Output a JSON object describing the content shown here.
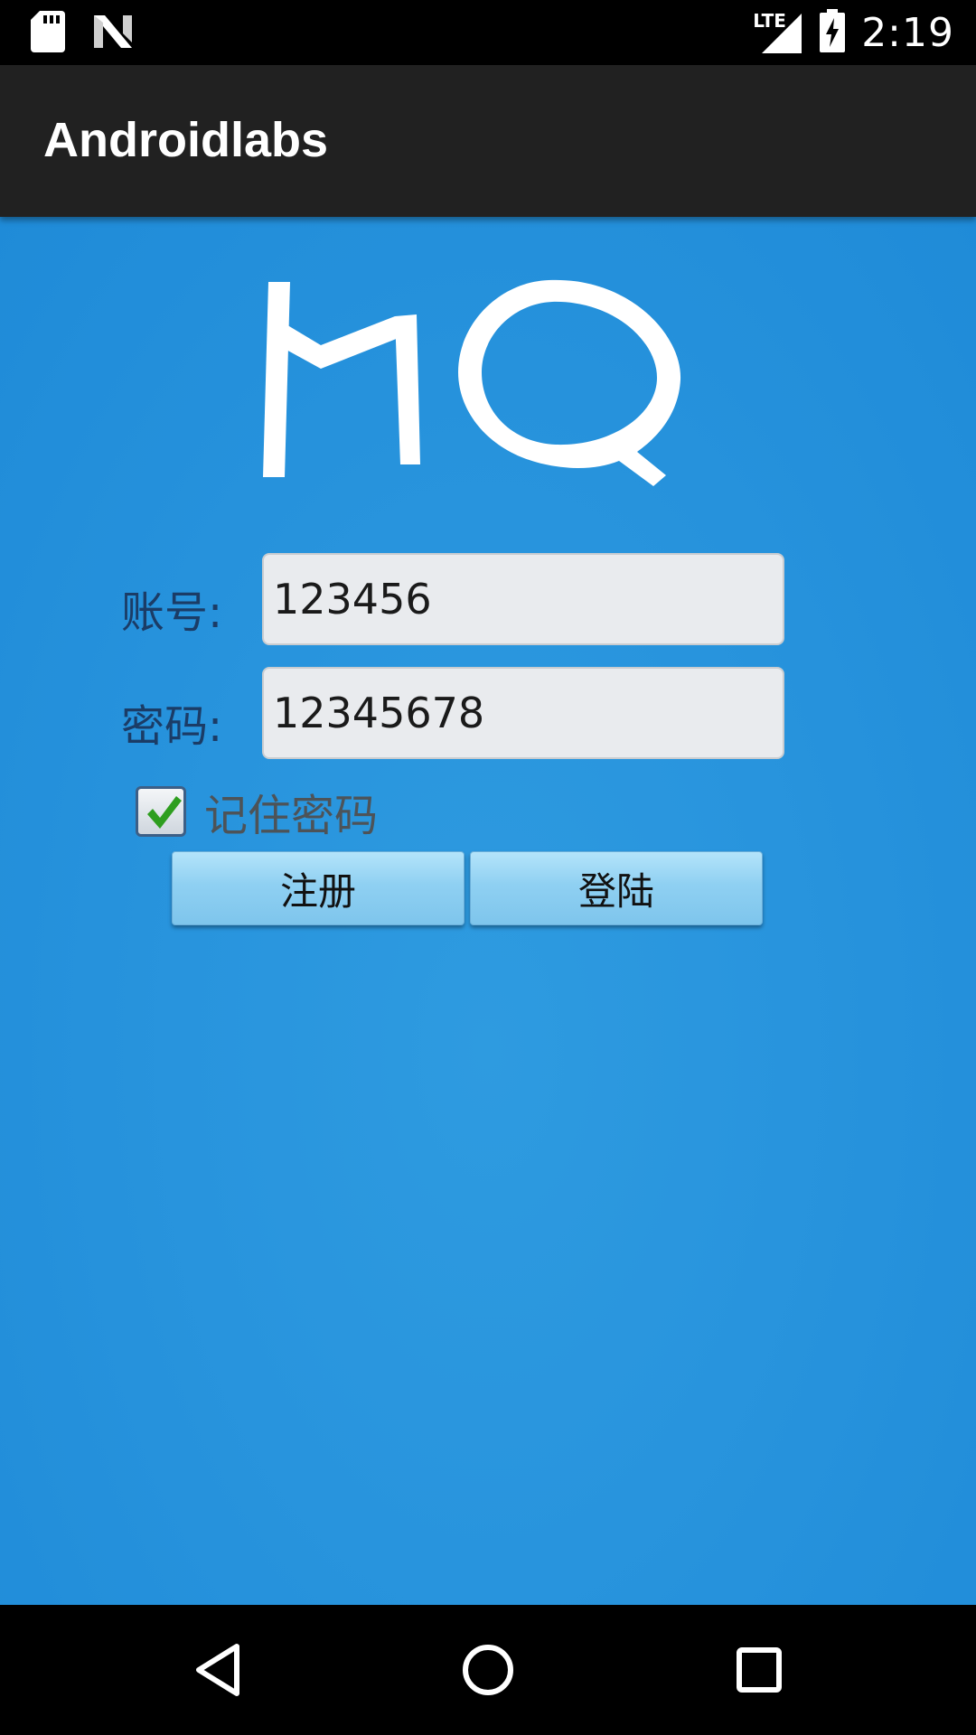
{
  "status_bar": {
    "time": "2:19",
    "network": "LTE",
    "icons": [
      "sd-card-icon",
      "n-logo-icon",
      "signal-icon",
      "battery-charging-icon"
    ]
  },
  "app_bar": {
    "title": "Androidlabs"
  },
  "login": {
    "logo_text": "MQ",
    "account_label": "账号:",
    "account_value": "123456",
    "password_label": "密码:",
    "password_value": "12345678",
    "remember_label": "记住密码",
    "remember_checked": true,
    "register_label": "注册",
    "login_label": "登陆"
  },
  "nav_bar": {
    "icons": [
      "back-icon",
      "home-icon",
      "recents-icon"
    ]
  },
  "colors": {
    "background": "#2894dd",
    "app_bar": "#212121",
    "button": "#8fd0f2",
    "input": "#e9ebee",
    "checkmark": "#2e9e1f"
  }
}
